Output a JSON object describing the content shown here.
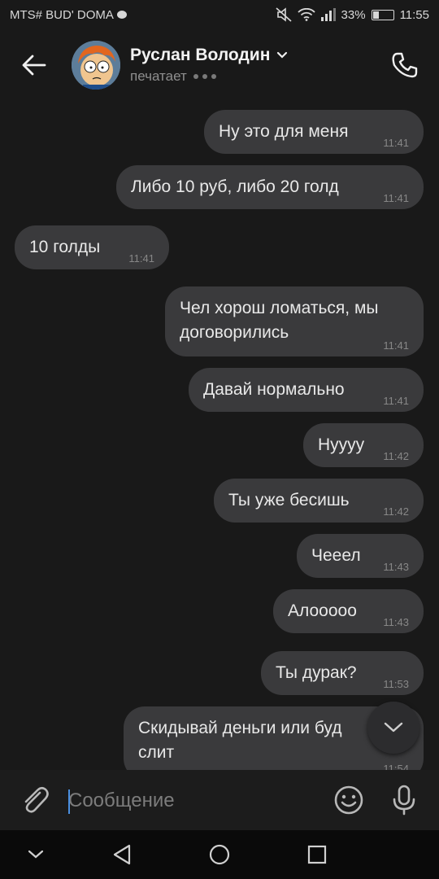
{
  "status_bar": {
    "carrier": "MTS# BUD' DOMA",
    "battery": "33%",
    "battery_level": 0.33,
    "time": "11:55"
  },
  "header": {
    "contact_name": "Руслан Володин",
    "status": "печатает"
  },
  "messages": [
    {
      "text": "Ну это для меня",
      "time": "11:41",
      "side": "out"
    },
    {
      "text": "Либо 10 руб, либо 20 голд",
      "time": "11:41",
      "side": "out"
    },
    {
      "text": "10 голды",
      "time": "11:41",
      "side": "in"
    },
    {
      "text": "Чел хорош ломаться, мы договорились",
      "time": "11:41",
      "side": "out"
    },
    {
      "text": "Давай нормально",
      "time": "11:41",
      "side": "out"
    },
    {
      "text": "Нуууу",
      "time": "11:42",
      "side": "out"
    },
    {
      "text": "Ты уже бесишь",
      "time": "11:42",
      "side": "out"
    },
    {
      "text": "Чееел",
      "time": "11:43",
      "side": "out"
    },
    {
      "text": "Алооооо",
      "time": "11:43",
      "side": "out"
    },
    {
      "text": "Ты дурак?",
      "time": "11:53",
      "side": "out"
    },
    {
      "text": "Скидывай деньги или буд слит",
      "time": "11:54",
      "side": "out"
    }
  ],
  "composer": {
    "placeholder": "Сообщение"
  },
  "icons": {
    "back": "arrow-left-icon",
    "call": "phone-icon",
    "attach": "paperclip-icon",
    "emoji": "smiley-icon",
    "mic": "microphone-icon",
    "scroll": "chevron-down-icon"
  },
  "colors": {
    "background": "#191919",
    "bubble": "#3a3a3c",
    "accent_caret": "#4a8fe0"
  }
}
